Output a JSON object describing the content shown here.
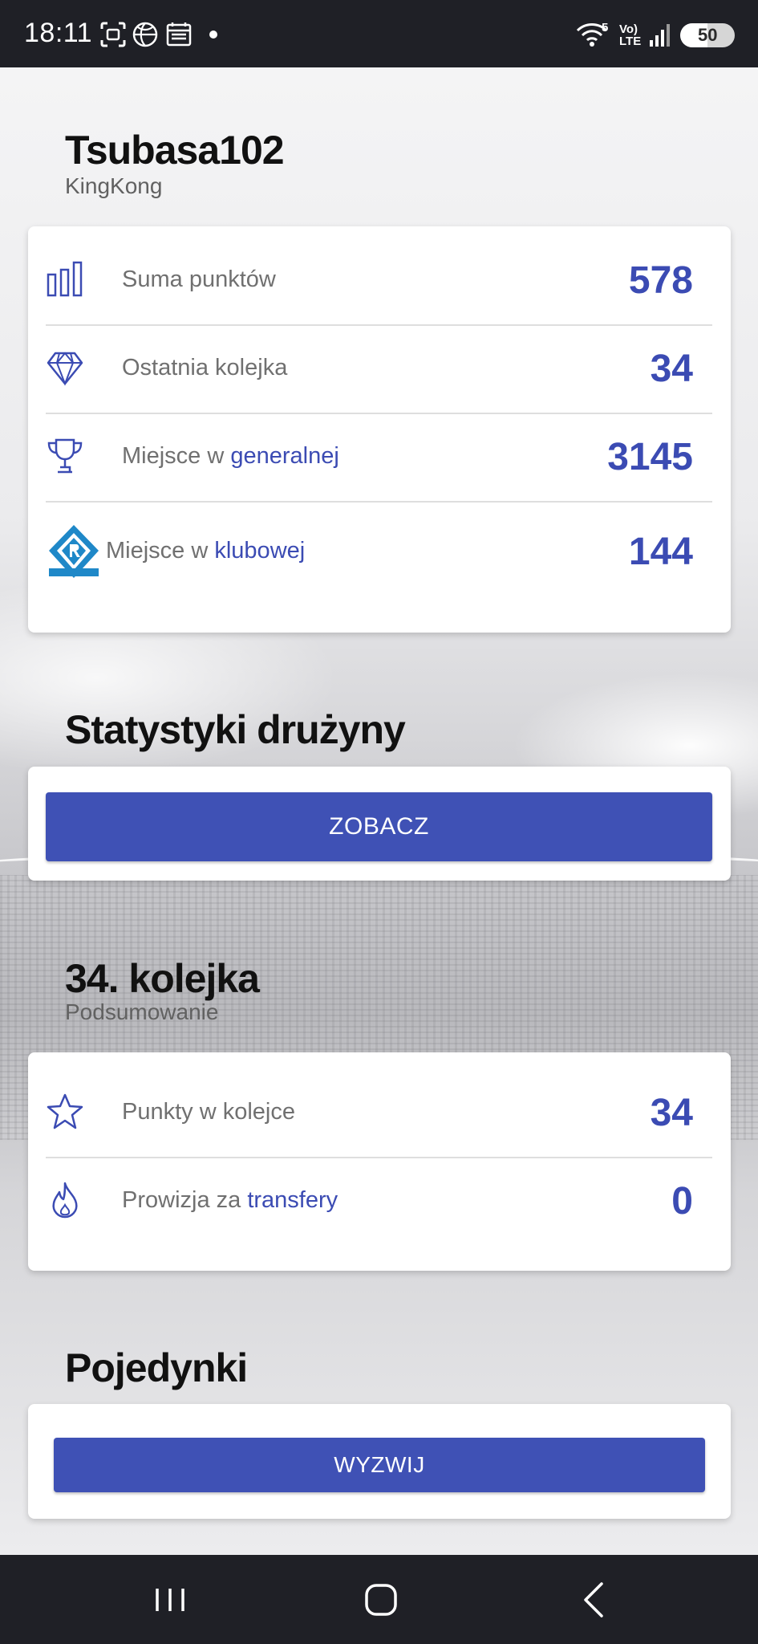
{
  "status_bar": {
    "time": "18:11",
    "icons": [
      "screenshot-icon",
      "globe-icon",
      "calendar-icon",
      "notification-dot-icon",
      "wifi-icon",
      "volte-icon",
      "signal-icon"
    ],
    "wifi_badge": "5",
    "volte_top": "Vo)",
    "volte_bottom": "LTE",
    "battery": "50",
    "battery_level": 0.5
  },
  "profile": {
    "team_name": "Tsubasa102",
    "user_name": "KingKong"
  },
  "stats": {
    "rows": [
      {
        "icon": "bar-chart-icon",
        "label": "Suma punktów",
        "label_accent": "",
        "value": "578"
      },
      {
        "icon": "diamond-icon",
        "label": "Ostatnia kolejka",
        "label_accent": "",
        "value": "34"
      },
      {
        "icon": "trophy-icon",
        "label": "Miejsce w ",
        "label_accent": "generalnej",
        "value": "3145"
      },
      {
        "icon": "club-crest-icon",
        "label": "Miejsce w ",
        "label_accent": "klubowej",
        "value": "144"
      }
    ]
  },
  "team_stats": {
    "title": "Statystyki drużyny",
    "button_label": "ZOBACZ"
  },
  "round": {
    "title": "34. kolejka",
    "subtitle": "Podsumowanie",
    "rows": [
      {
        "icon": "star-icon",
        "label": "Punkty w kolejce",
        "label_accent": "",
        "value": "34"
      },
      {
        "icon": "flame-icon",
        "label": "Prowizja za ",
        "label_accent": "transfery",
        "value": "0"
      }
    ]
  },
  "duels": {
    "title": "Pojedynki",
    "button_label": "WYZWIJ"
  },
  "colors": {
    "accent": "#3f51b5",
    "accent_text": "#3b4bb3",
    "system_bar": "#1f2026"
  },
  "nav_bar": {
    "buttons": [
      "recent-apps-icon",
      "home-icon",
      "back-icon"
    ]
  }
}
